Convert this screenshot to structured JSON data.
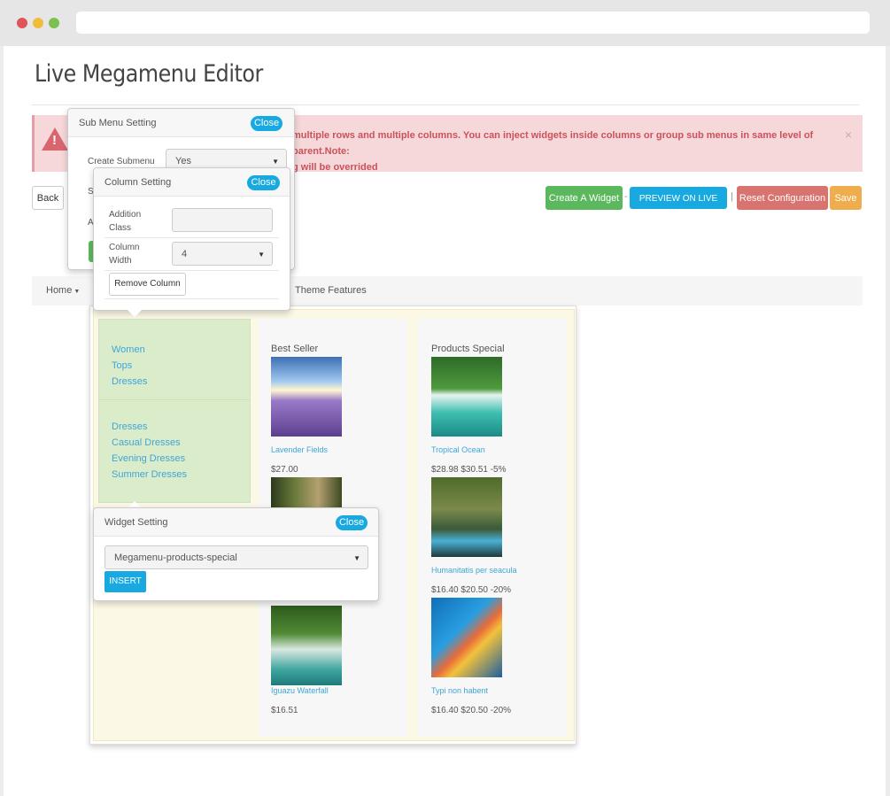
{
  "page": {
    "title": "Live Megamenu Editor"
  },
  "alert": {
    "text": "multiple rows and multiple columns. You can inject widgets inside columns or group sub menus in same level of parent.Note:",
    "text2": "g will be overrided",
    "close": "×"
  },
  "toolbar": {
    "back": "Back",
    "create_widget": "Create A Widget",
    "preview": "PREVIEW ON LIVE SITE",
    "reset": "Reset Configuration",
    "save": "Save",
    "sep1": "-",
    "sep2": "|"
  },
  "nav": {
    "home": "Home",
    "theme_features": "Theme Features"
  },
  "submenu_popup": {
    "title": "Sub Menu Setting",
    "close": "Close",
    "create_label": "Create Submenu",
    "create_value": "Yes",
    "row2_label": "S",
    "row3_label": "A"
  },
  "column_popup": {
    "title": "Column Setting",
    "close": "Close",
    "class_label_1": "Addition",
    "class_label_2": "Class",
    "class_value": "",
    "width_label_1": "Column",
    "width_label_2": "Width",
    "width_value": "4",
    "remove": "Remove Column"
  },
  "widget_popup": {
    "title": "Widget Setting",
    "close": "Close",
    "select_value": "Megamenu-products-special",
    "insert": "INSERT"
  },
  "menu_links": {
    "group1": [
      "Women",
      "Tops",
      "Dresses"
    ],
    "group2": [
      "Dresses",
      "Casual Dresses",
      "Evening Dresses",
      "Summer Dresses"
    ]
  },
  "best_seller": {
    "title": "Best Seller",
    "products": [
      {
        "name": "Lavender Fields",
        "price": "$27.00"
      },
      {
        "name": "Iguazu Waterfall",
        "price": "$16.51"
      }
    ]
  },
  "specials": {
    "title": "Products Special",
    "products": [
      {
        "name": "Tropical Ocean",
        "price": "$28.98 $30.51 -5%"
      },
      {
        "name": "Humanitatis per seacula",
        "price": "$16.40 $20.50 -20%"
      },
      {
        "name": "Typi non habent",
        "price": "$16.40 $20.50 -20%"
      }
    ]
  },
  "colors": {
    "accent": "#17a9e0",
    "success": "#5cb85c",
    "danger": "#d9736f",
    "warning": "#f0ad4e"
  },
  "icons": {
    "alert": "warning-icon",
    "caret": "caret-down-icon"
  }
}
